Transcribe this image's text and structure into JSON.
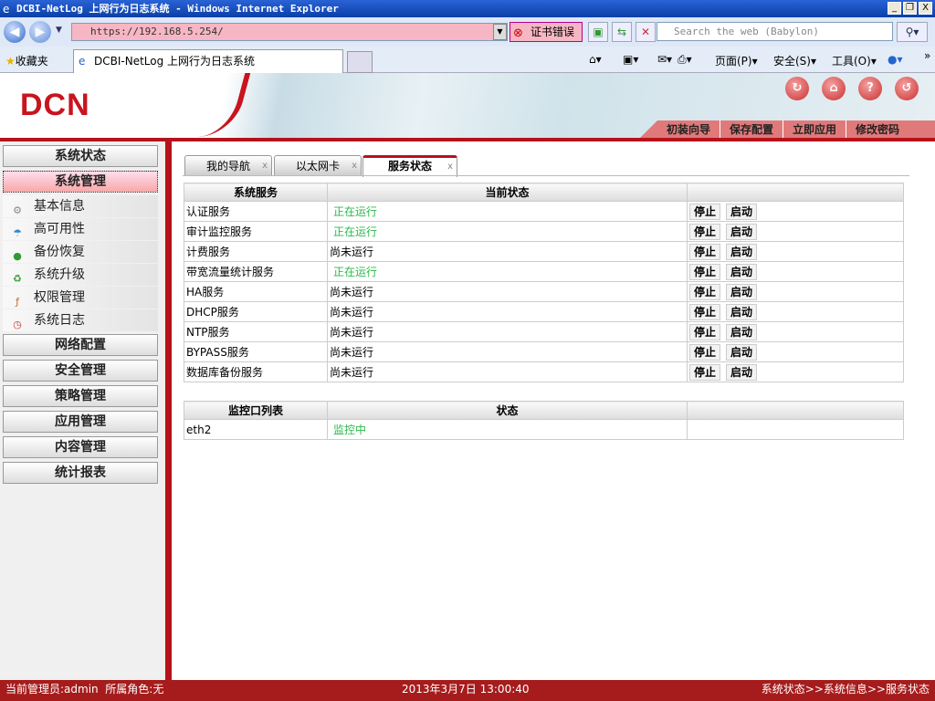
{
  "window": {
    "title": "DCBI-NetLog 上网行为日志系统 - Windows Internet Explorer",
    "min": "_",
    "max": "❐",
    "close": "X"
  },
  "browser": {
    "url": "https://192.168.5.254/",
    "cert_error": "证书错误",
    "search_placeholder": "Search the web (Babylon)",
    "favorites": "收藏夹",
    "tab_title": "DCBI-NetLog 上网行为日志系统",
    "page_menu": "页面(P)",
    "safety_menu": "安全(S)",
    "tools_menu": "工具(O)"
  },
  "header": {
    "logo": "DCN",
    "nav": [
      "初装向导",
      "保存配置",
      "立即应用",
      "修改密码"
    ]
  },
  "sidebar": {
    "top": [
      "系统状态",
      "系统管理"
    ],
    "items": [
      "基本信息",
      "高可用性",
      "备份恢复",
      "系统升级",
      "权限管理",
      "系统日志"
    ],
    "bottom": [
      "网络配置",
      "安全管理",
      "策略管理",
      "应用管理",
      "内容管理",
      "统计报表"
    ]
  },
  "tabs": [
    "我的导航",
    "以太网卡",
    "服务状态"
  ],
  "services": {
    "headers": [
      "系统服务",
      "当前状态",
      ""
    ],
    "stop": "停止",
    "start": "启动",
    "rows": [
      {
        "name": "认证服务",
        "status": "正在运行",
        "running": true
      },
      {
        "name": "审计监控服务",
        "status": "正在运行",
        "running": true
      },
      {
        "name": "计费服务",
        "status": "尚未运行",
        "running": false
      },
      {
        "name": "带宽流量统计服务",
        "status": "正在运行",
        "running": true
      },
      {
        "name": "HA服务",
        "status": "尚未运行",
        "running": false
      },
      {
        "name": "DHCP服务",
        "status": "尚未运行",
        "running": false
      },
      {
        "name": "NTP服务",
        "status": "尚未运行",
        "running": false
      },
      {
        "name": "BYPASS服务",
        "status": "尚未运行",
        "running": false
      },
      {
        "name": "数据库备份服务",
        "status": "尚未运行",
        "running": false
      }
    ]
  },
  "monitor": {
    "headers": [
      "监控口列表",
      "状态",
      ""
    ],
    "rows": [
      {
        "port": "eth2",
        "status": "监控中"
      }
    ]
  },
  "statusbar": {
    "user": "当前管理员:admin  所属角色:无",
    "datetime": "2013年3月7日 13:00:40",
    "breadcrumb": "系统状态>>系统信息>>服务状态"
  }
}
